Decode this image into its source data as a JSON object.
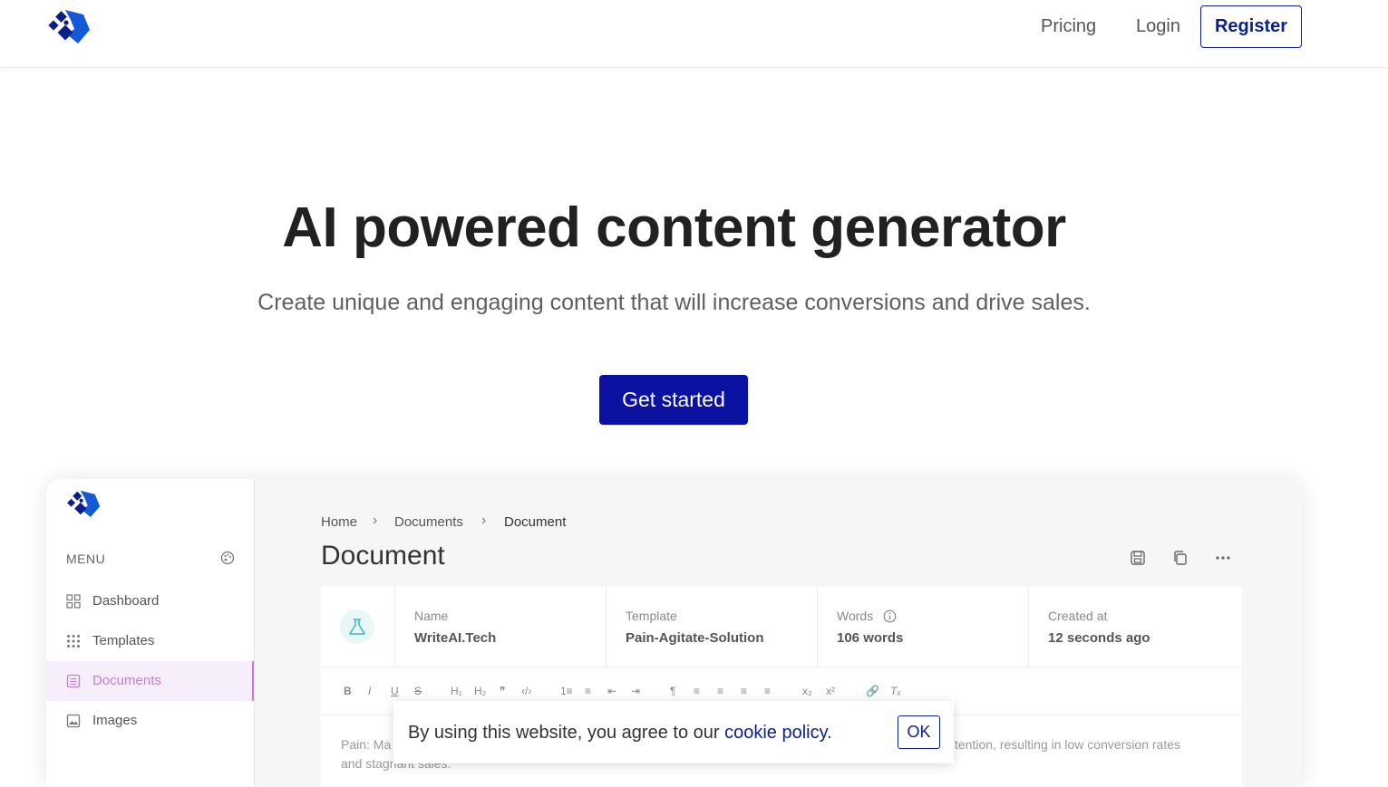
{
  "header": {
    "nav": {
      "pricing": "Pricing",
      "login": "Login",
      "register": "Register"
    }
  },
  "hero": {
    "title": "AI powered content generator",
    "subtitle": "Create unique and engaging content that will increase conversions and drive sales.",
    "cta": "Get started"
  },
  "preview": {
    "sidebar": {
      "menu_label": "MENU",
      "items": [
        {
          "label": "Dashboard",
          "icon": "grid-icon"
        },
        {
          "label": "Templates",
          "icon": "dots-grid-icon"
        },
        {
          "label": "Documents",
          "icon": "document-icon",
          "active": true
        },
        {
          "label": "Images",
          "icon": "image-icon"
        }
      ]
    },
    "breadcrumb": [
      "Home",
      "Documents",
      "Document"
    ],
    "title": "Document",
    "meta": {
      "name_label": "Name",
      "name_value": "WriteAI.Tech",
      "template_label": "Template",
      "template_value": "Pain-Agitate-Solution",
      "words_label": "Words",
      "words_value": "106 words",
      "created_label": "Created at",
      "created_value": "12 seconds ago"
    },
    "toolbar": [
      "B",
      "I",
      "U",
      "S",
      "H₁",
      "H₂",
      "❞",
      "‹/›",
      "1≡",
      "≡",
      "⇤",
      "⇥",
      "¶",
      "≡",
      "≡",
      "≡",
      "≡",
      "x₂",
      "x²",
      "🔗",
      "Tₓ"
    ],
    "editor_text": {
      "part1": "Pain: Ma",
      "part2": "tention, resulting in low conversion rates",
      "part3": "and stagnant sales."
    }
  },
  "cookie": {
    "text": "By using this website, you agree to our ",
    "link": "cookie policy",
    "dot": ".",
    "ok": "OK"
  },
  "colors": {
    "brand": "#0b1f8c",
    "cta": "#0b11a0",
    "active": "#c27be0"
  }
}
